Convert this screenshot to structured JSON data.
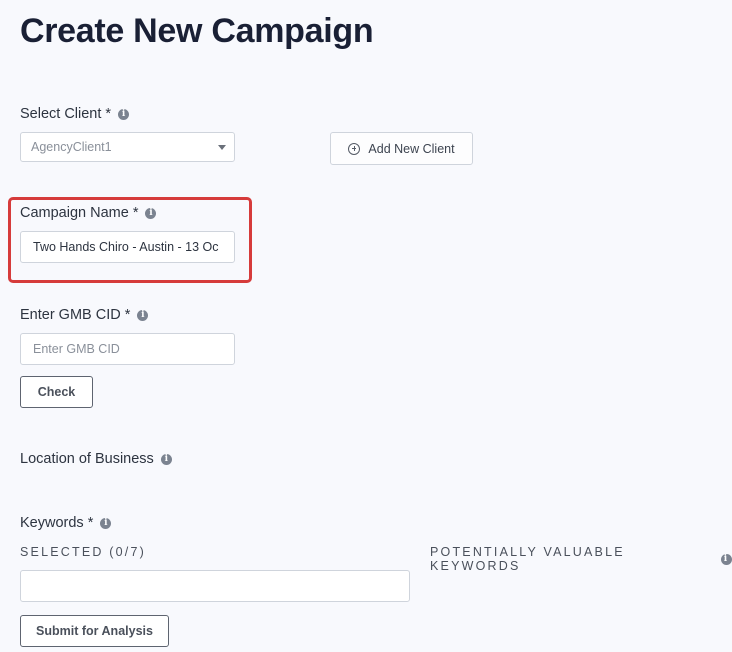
{
  "page": {
    "title": "Create New Campaign"
  },
  "client": {
    "label": "Select Client *",
    "selected": "AgencyClient1",
    "add_button_label": "Add New Client"
  },
  "campaign_name": {
    "label": "Campaign Name *",
    "value": "Two Hands Chiro - Austin - 13 Oc"
  },
  "gmb": {
    "label": "Enter GMB CID *",
    "placeholder": "Enter GMB CID",
    "check_button_label": "Check"
  },
  "location": {
    "label": "Location of Business"
  },
  "keywords": {
    "label": "Keywords *",
    "selected_label": "SELECTED (0/7)",
    "valuable_label": "POTENTIALLY VALUABLE KEYWORDS",
    "input_value": ""
  },
  "submit": {
    "label": "Submit for Analysis"
  },
  "colors": {
    "highlight": "#d63b3b",
    "background": "#f8f9fd",
    "title": "#1a2035"
  }
}
